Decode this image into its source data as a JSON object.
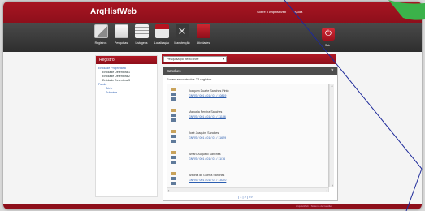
{
  "app": {
    "title": "ArqHistWeb"
  },
  "toplinks": [
    "Sobre o ArqHistWeb",
    "Ajuda"
  ],
  "toolbar": {
    "items": [
      {
        "label": "Registros",
        "icon": "records-icon"
      },
      {
        "label": "Pesquisas",
        "icon": "search-doc-icon"
      },
      {
        "label": "Listagens",
        "icon": "list-icon"
      },
      {
        "label": "Localização",
        "icon": "location-icon"
      },
      {
        "label": "Manutenção",
        "icon": "tools-icon"
      },
      {
        "label": "Atividades",
        "icon": "activities-icon"
      }
    ],
    "exit_label": "Sair"
  },
  "left_panel": {
    "title": "Registro",
    "tree": [
      {
        "text": "Entidade Proprietária",
        "level": 0
      },
      {
        "text": "Entidade Detentora 1",
        "level": 1
      },
      {
        "text": "Entidade Detentora 2",
        "level": 1
      },
      {
        "text": "Entidade Detentora 3",
        "level": 1
      },
      {
        "text": "Fundo",
        "level": 0
      },
      {
        "text": "Série",
        "level": 2
      },
      {
        "text": "Subsérie",
        "level": 2
      }
    ]
  },
  "search": {
    "select_value": "Pesquisa por texto livre"
  },
  "dialog": {
    "title": "Sanches",
    "count_text": "Foram encontrados 22 registos",
    "results": [
      {
        "name": "Joaquim Duarte Sanches Pinto",
        "code": "GNRS / 001 / 01 / 01 / 10819"
      },
      {
        "name": "Manuela Pereira Sanches",
        "code": "GNRS / 001 / 01 / 01 / 11186"
      },
      {
        "name": "José Joaquim Sanches",
        "code": "GNRS / 001 / 01 / 01 / 11629"
      },
      {
        "name": "Amaro Augusto Sanches",
        "code": "GNRS / 001 / 01 / 01 / 11/16"
      },
      {
        "name": "Antónia de Guerra Sanches",
        "code": "GNRS / 001 / 01 / 01 / 13070"
      }
    ],
    "pager": "| 1 | 2 | >>"
  },
  "footer": {
    "text": "ArqHistWeb - Sistema de Gestão"
  },
  "colors": {
    "brand_red": "#9c111d",
    "toolbar_dark": "#3a3a3a",
    "link_blue": "#2a5db0",
    "accent_green": "#3bb24a"
  }
}
